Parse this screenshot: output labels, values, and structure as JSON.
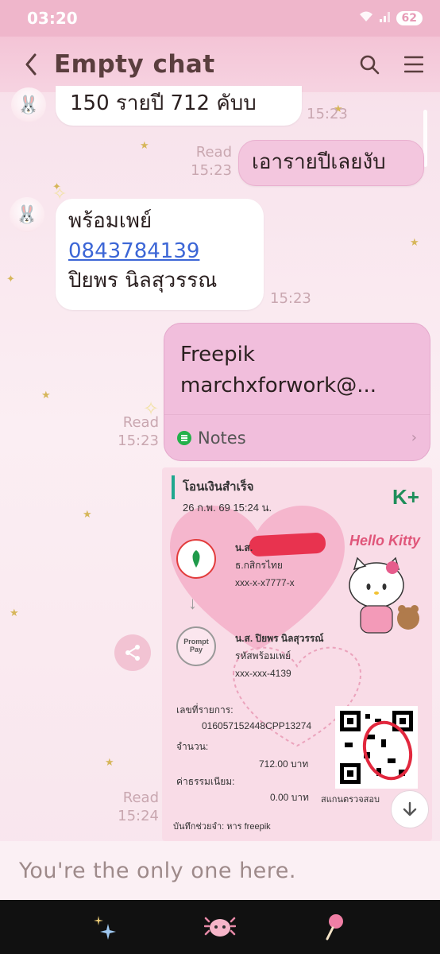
{
  "status_bar": {
    "time": "03:20",
    "battery": "62"
  },
  "header": {
    "title": "Empty chat"
  },
  "messages": [
    {
      "text": "150 รายปี 712 คับบ",
      "time": "15:23"
    },
    {
      "text": "เอารายปีเลยงับ",
      "read": "Read",
      "time": "15:23"
    },
    {
      "lines": [
        "พร้อมเพย์",
        "0843784139",
        "ปิยพร นิลสุวรรณ"
      ],
      "time": "15:23"
    }
  ],
  "note": {
    "line1": "Freepik",
    "line2": "marchxforwork@...",
    "label": "Notes",
    "read": "Read",
    "time": "15:23"
  },
  "receipt": {
    "title": "โอนเงินสำเร็จ",
    "date": "26 ก.พ. 69  15:24 น.",
    "logo": "K+",
    "sender_name": "น.ส.",
    "sender_bank": "ธ.กสิกรไทย",
    "sender_account": "xxx-x-x7777-x",
    "receiver_name": "น.ส. ปิยพร นิลสุวรรณ์",
    "receiver_type": "รหัสพร้อมเพย์",
    "receiver_account": "xxx-xxx-4139",
    "promptpay_label": "Prompt Pay",
    "ref_label": "เลขที่รายการ:",
    "ref_value": "016057152448CPP13274",
    "amount_label": "จำนวน:",
    "amount_value": "712.00 บาท",
    "fee_label": "ค่าธรรมเนียม:",
    "fee_value": "0.00 บาท",
    "memo": "บันทึกช่วยจำ: หาร freepik",
    "brand": "Hello Kitty",
    "scan_text": "สแกนตรวจสอบ",
    "read": "Read",
    "time": "15:24"
  },
  "input": {
    "placeholder": "You're the only one here."
  },
  "colors": {
    "accent": "#efb6cb",
    "out_bubble": "#f3c6de",
    "link": "#3c66d6"
  },
  "icons": [
    "back-icon",
    "search-icon",
    "menu-icon",
    "share-icon",
    "arrow-down-icon",
    "sparkle-star-icon",
    "axolotl-icon",
    "lollipop-icon"
  ]
}
